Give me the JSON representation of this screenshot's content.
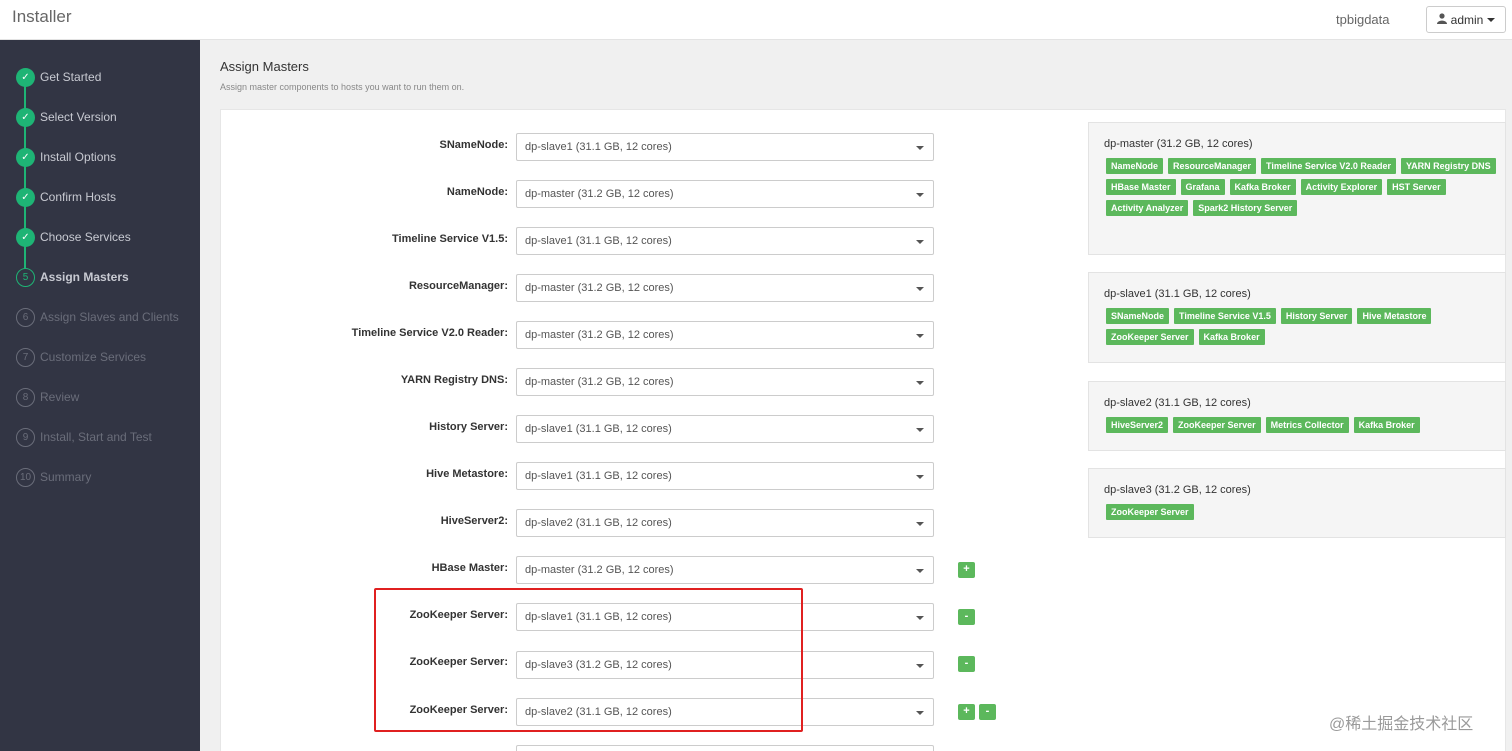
{
  "app": {
    "title": "Installer",
    "cluster_name": "tpbigdata",
    "user_label": "admin"
  },
  "sidebar": {
    "steps": [
      {
        "label": "Get Started",
        "marker": "✓",
        "state": "done"
      },
      {
        "label": "Select Version",
        "marker": "✓",
        "state": "done"
      },
      {
        "label": "Install Options",
        "marker": "✓",
        "state": "done"
      },
      {
        "label": "Confirm Hosts",
        "marker": "✓",
        "state": "done"
      },
      {
        "label": "Choose Services",
        "marker": "✓",
        "state": "done"
      },
      {
        "label": "Assign Masters",
        "marker": "5",
        "state": "current"
      },
      {
        "label": "Assign Slaves and Clients",
        "marker": "6",
        "state": "todo"
      },
      {
        "label": "Customize Services",
        "marker": "7",
        "state": "todo"
      },
      {
        "label": "Review",
        "marker": "8",
        "state": "todo"
      },
      {
        "label": "Install, Start and Test",
        "marker": "9",
        "state": "todo"
      },
      {
        "label": "Summary",
        "marker": "10",
        "state": "todo"
      }
    ]
  },
  "main": {
    "title": "Assign Masters",
    "subtitle": "Assign master components to hosts you want to run them on.",
    "assignments": [
      {
        "label": "SNameNode:",
        "value": "dp-slave1 (31.1 GB, 12 cores)"
      },
      {
        "label": "NameNode:",
        "value": "dp-master (31.2 GB, 12 cores)"
      },
      {
        "label": "Timeline Service V1.5:",
        "value": "dp-slave1 (31.1 GB, 12 cores)"
      },
      {
        "label": "ResourceManager:",
        "value": "dp-master (31.2 GB, 12 cores)"
      },
      {
        "label": "Timeline Service V2.0 Reader:",
        "value": "dp-master (31.2 GB, 12 cores)"
      },
      {
        "label": "YARN Registry DNS:",
        "value": "dp-master (31.2 GB, 12 cores)"
      },
      {
        "label": "History Server:",
        "value": "dp-slave1 (31.1 GB, 12 cores)"
      },
      {
        "label": "Hive Metastore:",
        "value": "dp-slave1 (31.1 GB, 12 cores)"
      },
      {
        "label": "HiveServer2:",
        "value": "dp-slave2 (31.1 GB, 12 cores)"
      },
      {
        "label": "HBase Master:",
        "value": "dp-master (31.2 GB, 12 cores)"
      },
      {
        "label": "ZooKeeper Server:",
        "value": "dp-slave1 (31.1 GB, 12 cores)"
      },
      {
        "label": "ZooKeeper Server:",
        "value": "dp-slave3 (31.2 GB, 12 cores)"
      },
      {
        "label": "ZooKeeper Server:",
        "value": "dp-slave2 (31.1 GB, 12 cores)"
      }
    ],
    "add_label": "+",
    "remove_label": "-"
  },
  "hosts": [
    {
      "name": "dp-master (31.2 GB, 12 cores)",
      "components": [
        "NameNode",
        "ResourceManager",
        "Timeline Service V2.0 Reader",
        "YARN Registry DNS",
        "HBase Master",
        "Grafana",
        "Kafka Broker",
        "Activity Explorer",
        "HST Server",
        "Activity Analyzer",
        "Spark2 History Server"
      ]
    },
    {
      "name": "dp-slave1 (31.1 GB, 12 cores)",
      "components": [
        "SNameNode",
        "Timeline Service V1.5",
        "History Server",
        "Hive Metastore",
        "ZooKeeper Server",
        "Kafka Broker"
      ]
    },
    {
      "name": "dp-slave2 (31.1 GB, 12 cores)",
      "components": [
        "HiveServer2",
        "ZooKeeper Server",
        "Metrics Collector",
        "Kafka Broker"
      ]
    },
    {
      "name": "dp-slave3 (31.2 GB, 12 cores)",
      "components": [
        "ZooKeeper Server"
      ]
    }
  ],
  "watermark": "@稀土掘金技术社区",
  "colors": {
    "sidebar_bg": "#323544",
    "accent_green": "#1eb475",
    "badge_green": "#5cb85c",
    "highlight_red": "#e02020"
  }
}
